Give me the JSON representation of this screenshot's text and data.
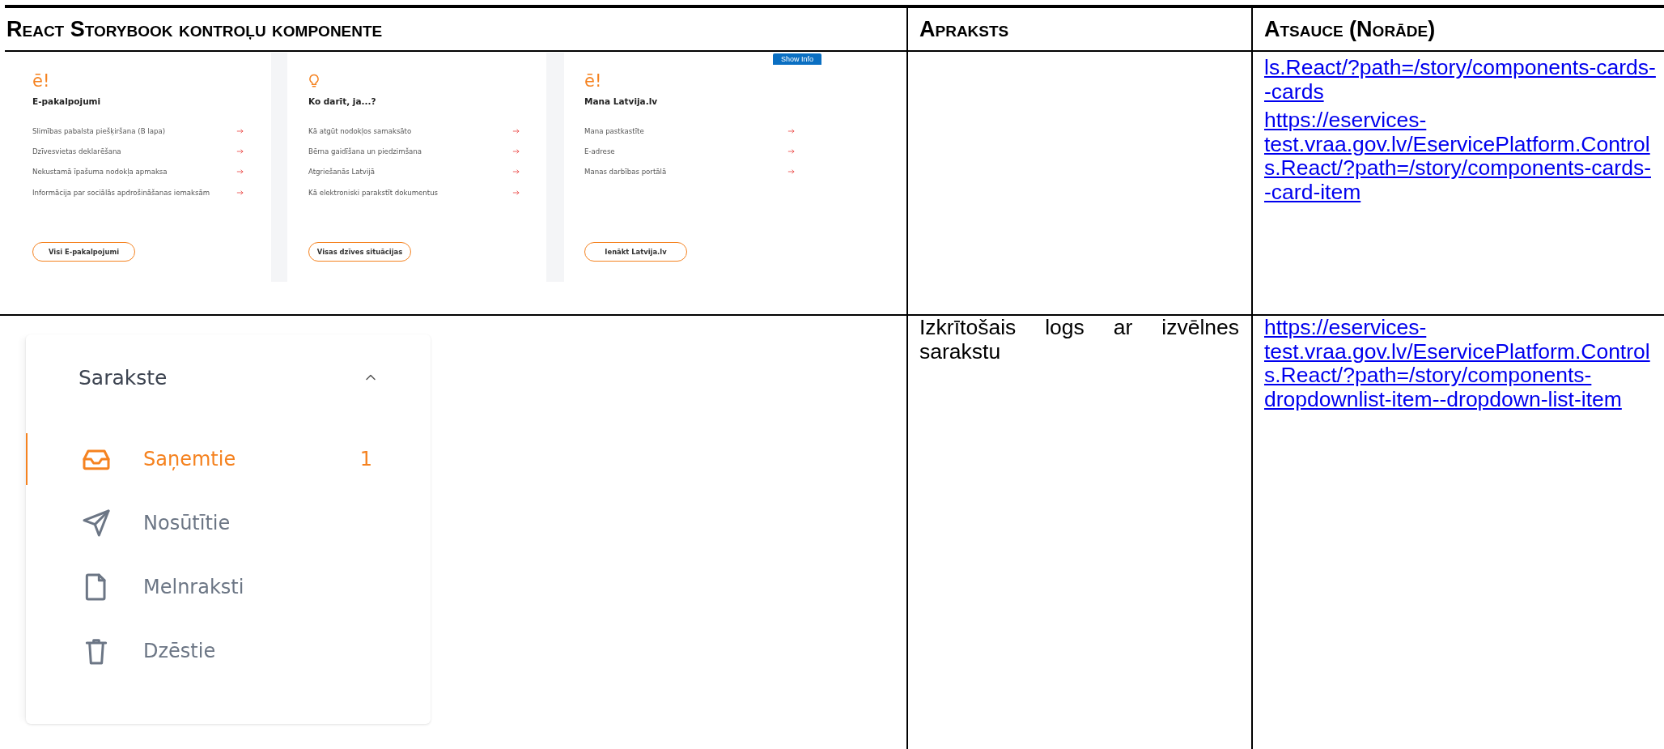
{
  "table": {
    "columns": [
      "React Storybook kontroļu komponente",
      "Apraksts",
      "Atsauce (Norāde)"
    ],
    "rows": [
      {
        "component": {
          "kind": "cards",
          "show_info_button": "Show Info",
          "cards": [
            {
              "logo": "ē!",
              "title": "E-pakalpojumi",
              "items": [
                "Slimības pabalsta piešķiršana (B lapa)",
                "Dzīvesvietas deklarēšana",
                "Nekustamā īpašuma nodokļa apmaksa",
                "Informācija par sociālās apdrošināšanas iemaksām"
              ],
              "button": "Visi E-pakalpojumi"
            },
            {
              "title": "Ko darīt, ja...?",
              "items": [
                "Kā atgūt nodokļos samaksāto",
                "Bērna gaidīšana un piedzimšana",
                "Atgriešanās Latvijā",
                "Kā elektroniski parakstīt dokumentus"
              ],
              "button": "Visas dzīves situācijas"
            },
            {
              "logo": "ē!",
              "title": "Mana Latvija.lv",
              "items": [
                "Mana pastkastīte",
                "E-adrese",
                "Manas darbības portālā"
              ],
              "button": "Ienākt Latvija.lv"
            }
          ]
        },
        "links": [
          "ls.React/?path=/story/components-cards--cards",
          "https://eservices-test.vraa.gov.lv/EservicePlatform.Controls.React/?path=/story/components-cards--card-item"
        ]
      },
      {
        "component": {
          "kind": "dropdown",
          "title": "Sarakste",
          "expanded": true,
          "items": [
            {
              "label": "Saņemtie",
              "count": "1",
              "selected": true
            },
            {
              "label": "Nosūtītie",
              "selected": false
            },
            {
              "label": "Melnraksti",
              "selected": false
            },
            {
              "label": "Dzēstie",
              "selected": false
            }
          ]
        },
        "description": "Izkrītošais logs ar izvēlnes sarakstu",
        "links": [
          "https://eservices-test.vraa.gov.lv/EservicePlatform.Controls.React/?path=/story/components-dropdownlist-item--dropdown-list-item"
        ]
      }
    ]
  }
}
